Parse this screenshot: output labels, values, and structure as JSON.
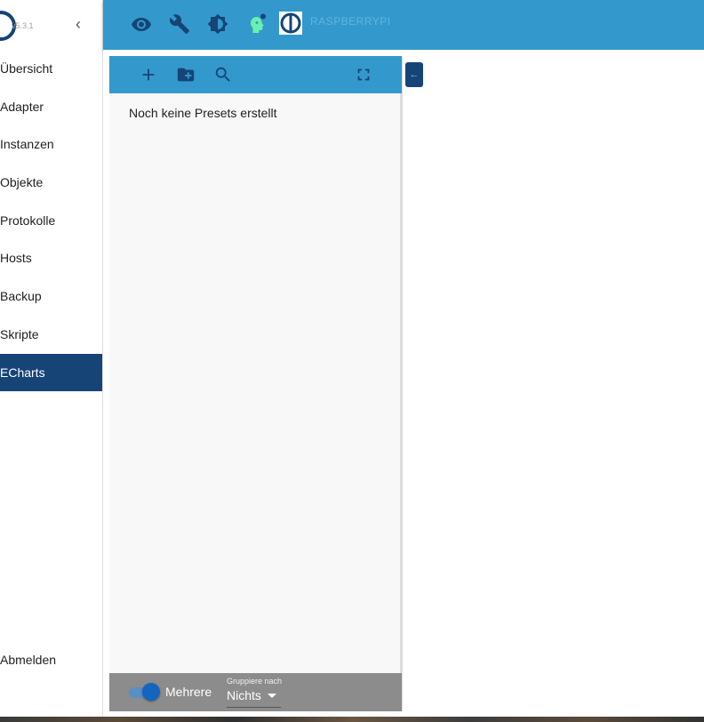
{
  "sidebar": {
    "version": "v5.3.1",
    "collapse_icon": "chevron-left-icon",
    "items": [
      {
        "label": "Übersicht",
        "active": false
      },
      {
        "label": "Adapter",
        "active": false
      },
      {
        "label": "Instanzen",
        "active": false
      },
      {
        "label": "Objekte",
        "active": false
      },
      {
        "label": "Protokolle",
        "active": false
      },
      {
        "label": "Hosts",
        "active": false
      },
      {
        "label": "Backup",
        "active": false
      },
      {
        "label": "Skripte",
        "active": false
      },
      {
        "label": "ECharts",
        "active": true
      }
    ],
    "logout_label": "Abmelden"
  },
  "topbar": {
    "icons": [
      "eye-icon",
      "wrench-icon",
      "brightness-icon",
      "expert-mode-icon",
      "iobroker-logo-icon"
    ],
    "host": "RASPBERRYPI"
  },
  "panel": {
    "toolbar_icons": [
      "add-icon",
      "add-folder-icon",
      "search-icon",
      "fullscreen-icon"
    ],
    "empty_message": "Noch keine Presets erstellt",
    "footer": {
      "toggle_label": "Mehrere",
      "toggle_on": true,
      "group_label": "Gruppiere nach",
      "group_value": "Nichts"
    }
  },
  "colors": {
    "accent": "#3399cc",
    "active_nav": "#164477",
    "footer": "#8c8c8c"
  }
}
